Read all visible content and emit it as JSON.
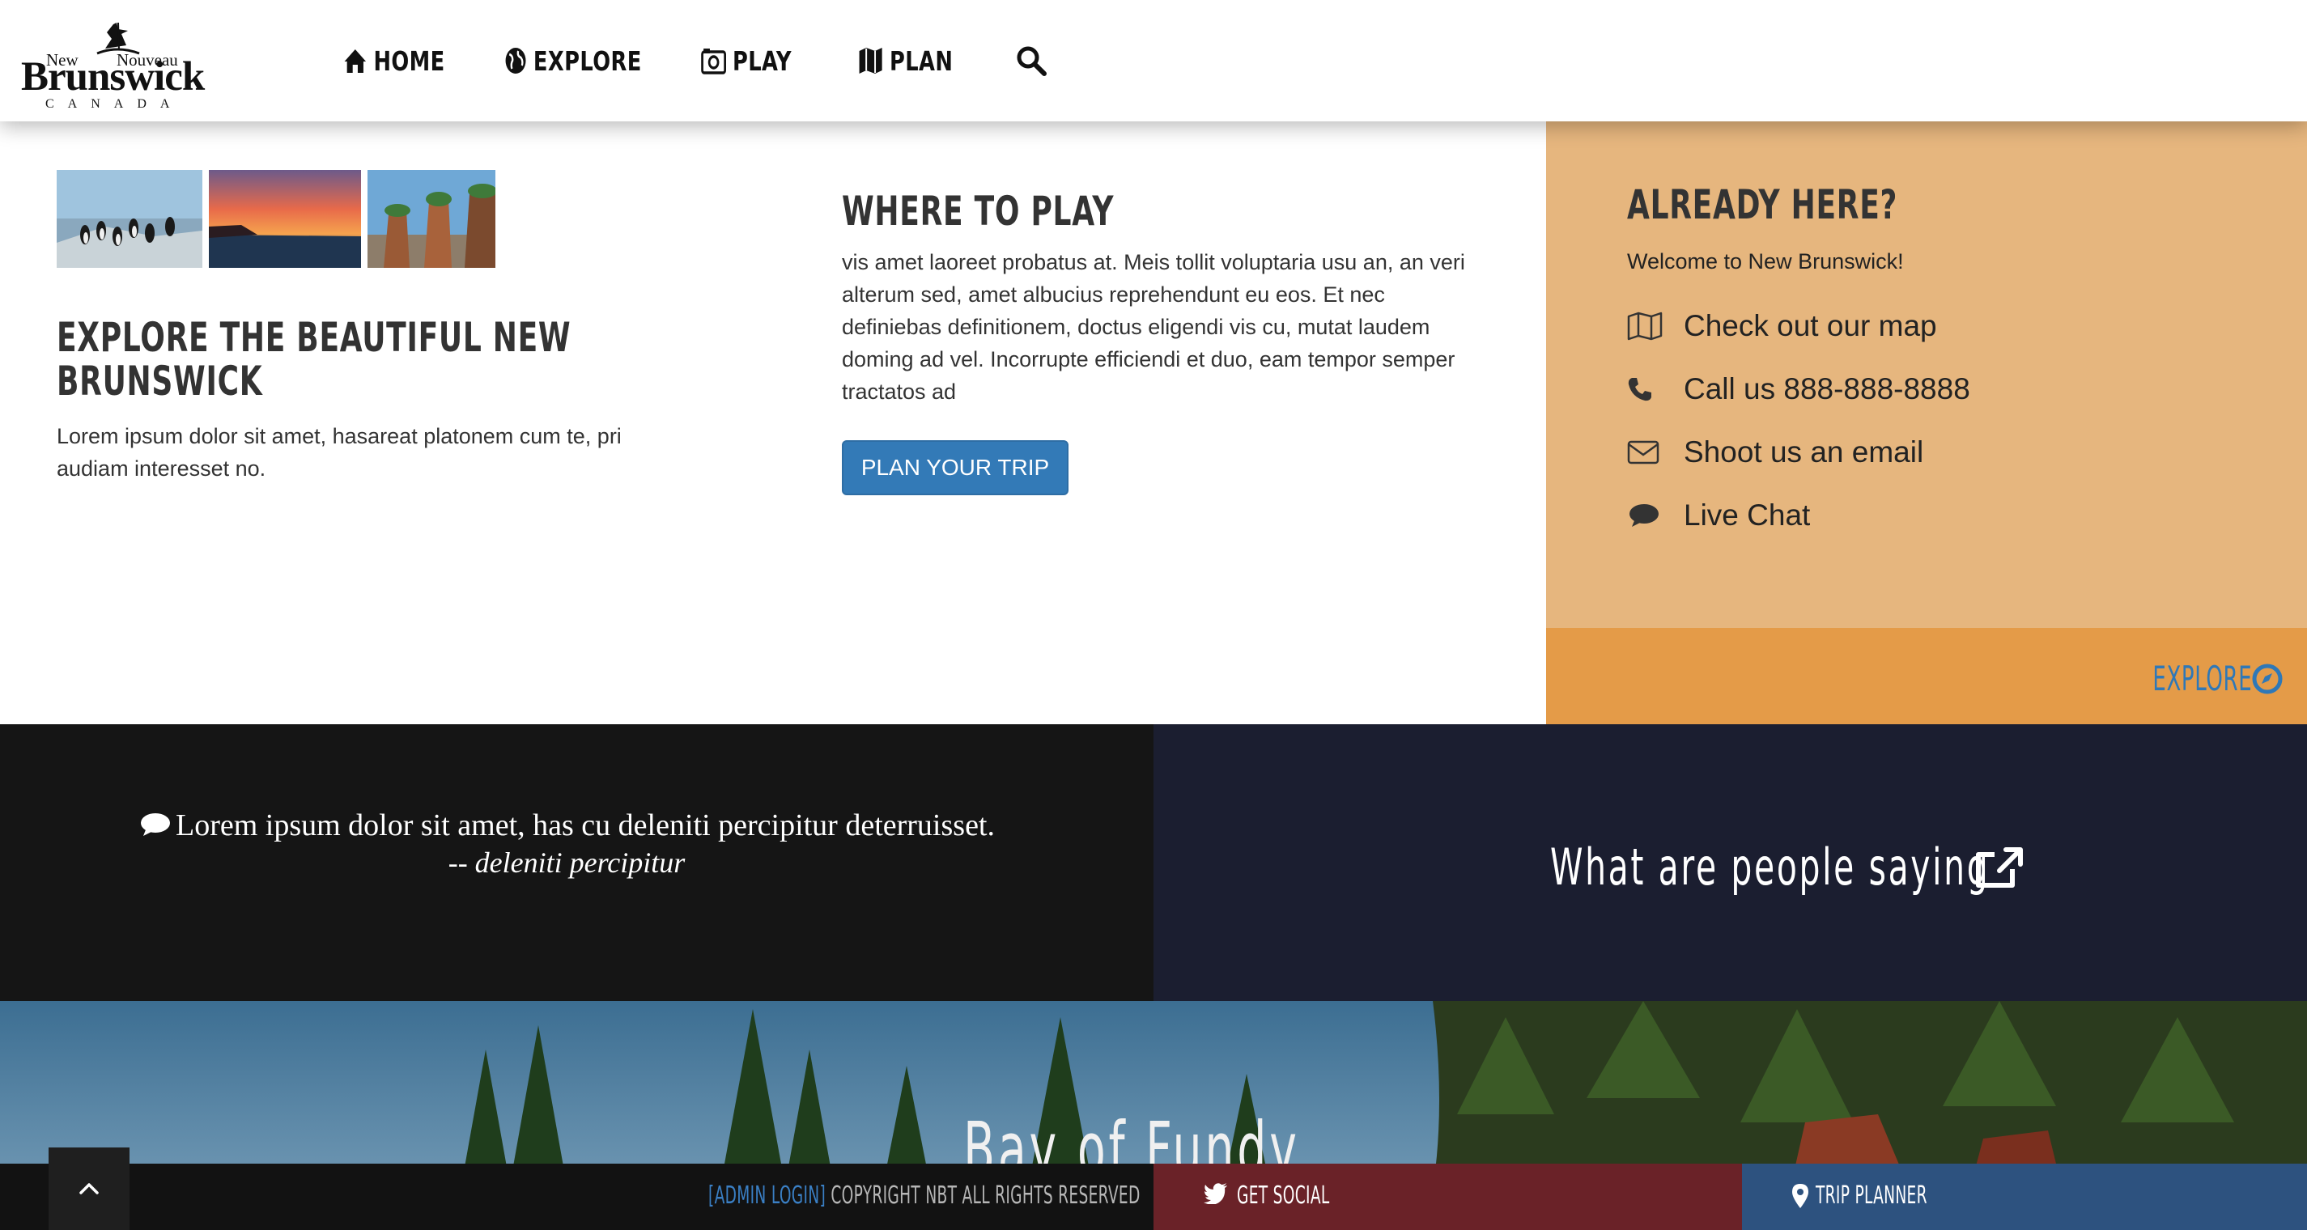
{
  "brand": {
    "new": "New",
    "nouveau": "Nouveau",
    "name": "Brunswick",
    "country": "CANADA"
  },
  "nav": {
    "home": "HOME",
    "explore": "EXPLORE",
    "play": "PLAY",
    "plan": "PLAN"
  },
  "explore_section": {
    "title": "EXPLORE THE BEAUTIFUL NEW BRUNSWICK",
    "body": "Lorem ipsum dolor sit amet, hasareat platonem cum te, pri audiam interesset no."
  },
  "play_section": {
    "title": "WHERE TO PLAY",
    "body": "vis amet laoreet probatus at. Meis tollit voluptaria usu an, an veri alterum sed, amet albucius reprehendunt eu eos. Et nec definiebas definitionem, doctus eligendi vis cu, mutat laudem doming ad vel. Incorrupte efficiendi et duo, eam tempor semper tractatos ad",
    "button": "PLAN YOUR TRIP"
  },
  "already_here": {
    "title": "ALREADY HERE?",
    "welcome": "Welcome to New Brunswick!",
    "map": "Check out our map",
    "call": "Call us 888-888-8888",
    "email": "Shoot us an email",
    "chat": "Live Chat",
    "explore_link": "EXPLORE"
  },
  "quote": {
    "text": "Lorem ipsum dolor sit amet, has cu deleniti percipitur deterruisset.",
    "author": "-- deleniti percipitur"
  },
  "saying": {
    "text": "What are people saying"
  },
  "hero": {
    "title": "Bay of Fundy"
  },
  "footer": {
    "admin": "[ADMIN LOGIN]",
    "copyright": "COPYRIGHT NBT ALL RIGHTS RESERVED",
    "social": "GET SOCIAL",
    "trip": "TRIP PLANNER"
  },
  "colors": {
    "panel": "#e6b67e",
    "explore_bar": "#e49b48",
    "link_blue": "#2f78b7",
    "button_blue": "#337ab7",
    "quote_bg": "#151515",
    "saying_bg": "#1b1e30",
    "social_red": "#6a2228",
    "trip_blue": "#2d527f"
  },
  "icons": [
    "home-icon",
    "globe-icon",
    "camera-icon",
    "map-icon",
    "search-icon",
    "phone-icon",
    "envelope-icon",
    "comment-icon",
    "compass-icon",
    "external-link-icon",
    "twitter-icon",
    "map-marker-icon",
    "chevron-up-icon"
  ]
}
